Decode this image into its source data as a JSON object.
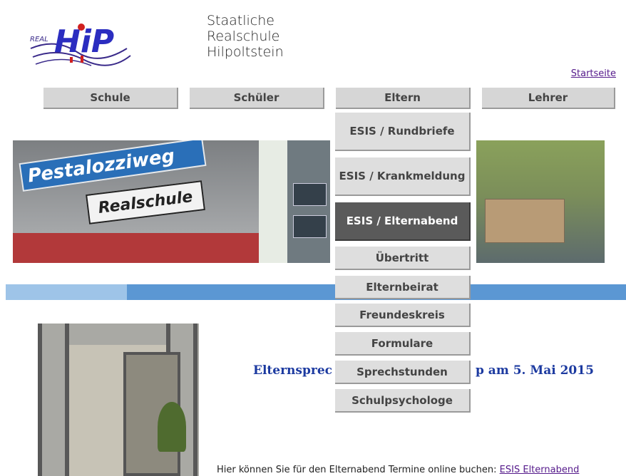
{
  "header": {
    "logo_text": "HiP",
    "school_lines": [
      "Staatliche",
      "Realschule",
      "Hilpoltstein"
    ],
    "startseite_link": "Startseite"
  },
  "nav": {
    "items": [
      "Schule",
      "Schüler",
      "Eltern",
      "Lehrer"
    ]
  },
  "dropdown": {
    "items": [
      {
        "label": "ESIS / Rundbriefe",
        "active": false
      },
      {
        "label": "ESIS / Krankmeldung",
        "active": false
      },
      {
        "label": "ESIS / Elternabend",
        "active": true
      },
      {
        "label": "Übertritt",
        "active": false
      },
      {
        "label": "Elternbeirat",
        "active": false
      },
      {
        "label": "Freundeskreis",
        "active": false
      },
      {
        "label": "Formulare",
        "active": false
      },
      {
        "label": "Sprechstunden",
        "active": false
      },
      {
        "label": "Schulpsychologe",
        "active": false
      }
    ]
  },
  "banner": {
    "sign_blue": "Pestalozziweg",
    "sign_white": "Realschule"
  },
  "content": {
    "headline_left": "Elternsprec",
    "headline_right": "p am 5. Mai 2015",
    "footer_text": "Hier können Sie für den Elternabend Termine online buchen: ",
    "footer_link": "ESIS Elternabend"
  },
  "colors": {
    "headline": "#1c3aa0",
    "active_item": "#5a5a5a",
    "nav_bg": "#d6d6d6",
    "stripe": "#5b97d3"
  }
}
